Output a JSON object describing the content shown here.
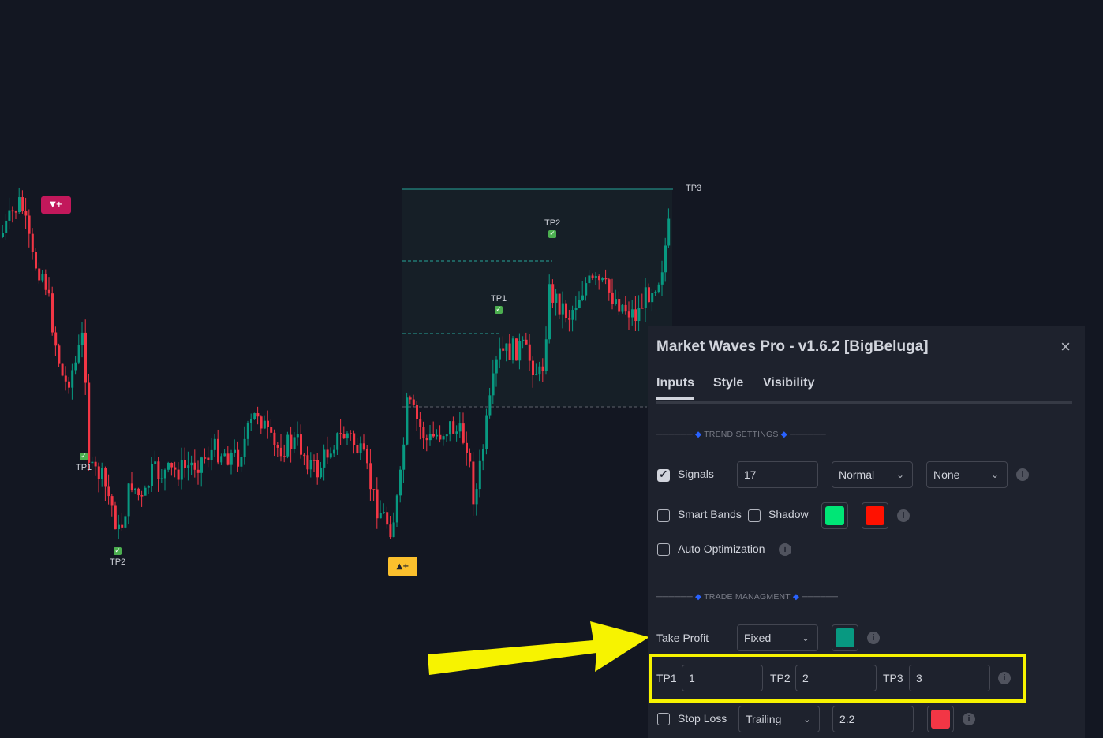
{
  "chart": {
    "tp_labels": {
      "tp3_line": "TP3",
      "tp2_right": "TP2",
      "tp1_right": "TP1",
      "tp1_left": "TP1",
      "tp2_left": "TP2"
    },
    "sell_signal_label": "▼+",
    "buy_signal_label": "▲+",
    "colors": {
      "up": "#089981",
      "down": "#f23645",
      "zone": "#1a2a30",
      "accent": "#26a69a"
    }
  },
  "panel": {
    "title": "Market Waves Pro - v1.6.2 [BigBeluga]",
    "close_icon": "×",
    "tabs": [
      "Inputs",
      "Style",
      "Visibility"
    ],
    "active_tab": "Inputs",
    "sections": {
      "trend": "TREND SETTINGS",
      "trade": "TRADE MANAGMENT"
    },
    "signals": {
      "label": "Signals",
      "checked": true,
      "value": "17",
      "mode": "Normal",
      "filter": "None"
    },
    "smart_bands": {
      "label": "Smart Bands",
      "checked": false
    },
    "shadow": {
      "label": "Shadow",
      "checked": false,
      "color_up": "#00e676",
      "color_down": "#ff1100"
    },
    "auto_opt": {
      "label": "Auto Optimization",
      "checked": false
    },
    "take_profit": {
      "label": "Take Profit",
      "mode": "Fixed",
      "color": "#089981"
    },
    "tp1": {
      "label": "TP1",
      "value": "1"
    },
    "tp2": {
      "label": "TP2",
      "value": "2"
    },
    "tp3": {
      "label": "TP3",
      "value": "3"
    },
    "stop_loss": {
      "label": "Stop Loss",
      "checked": false,
      "mode": "Trailing",
      "value": "2.2",
      "color": "#f23645"
    },
    "info_icon": "i",
    "chevron": "⌄"
  },
  "annotation": {
    "arrow_color": "#f7f300",
    "box_color": "#f7f300"
  }
}
